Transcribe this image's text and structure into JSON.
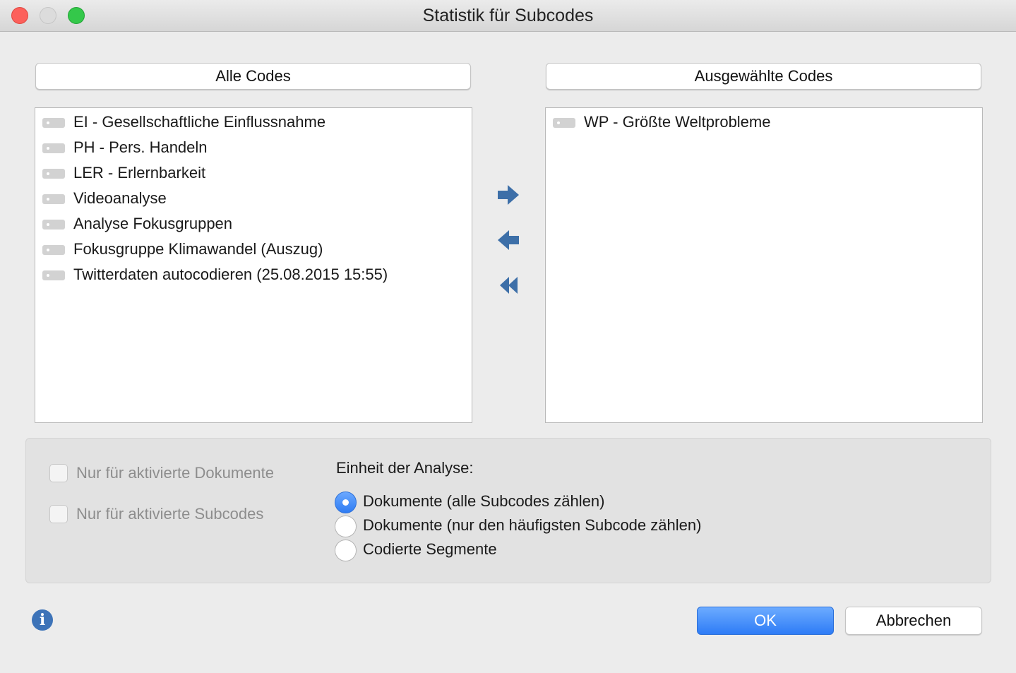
{
  "window": {
    "title": "Statistik für Subcodes"
  },
  "left_panel": {
    "header": "Alle Codes",
    "items": [
      "EI - Gesellschaftliche Einflussnahme",
      "PH - Pers. Handeln",
      "LER - Erlernbarkeit",
      "Videoanalyse",
      "Analyse Fokusgruppen",
      "Fokusgruppe Klimawandel (Auszug)",
      "Twitterdaten autocodieren (25.08.2015 15:55)"
    ]
  },
  "right_panel": {
    "header": "Ausgewählte Codes",
    "items": [
      "WP - Größte Weltprobleme"
    ]
  },
  "options": {
    "checkbox_documents": "Nur für aktivierte Dokumente",
    "checkbox_subcodes": "Nur für aktivierte Subcodes",
    "unit_label": "Einheit der Analyse:",
    "radio_options": [
      "Dokumente (alle Subcodes zählen)",
      "Dokumente (nur den häufigsten Subcode zählen)",
      "Codierte Segmente"
    ],
    "selected_radio": 0
  },
  "buttons": {
    "ok": "OK",
    "cancel": "Abbrechen"
  },
  "colors": {
    "accent": "#2e7cf6",
    "arrow": "#3d6fa8",
    "info": "#3d73b8"
  }
}
